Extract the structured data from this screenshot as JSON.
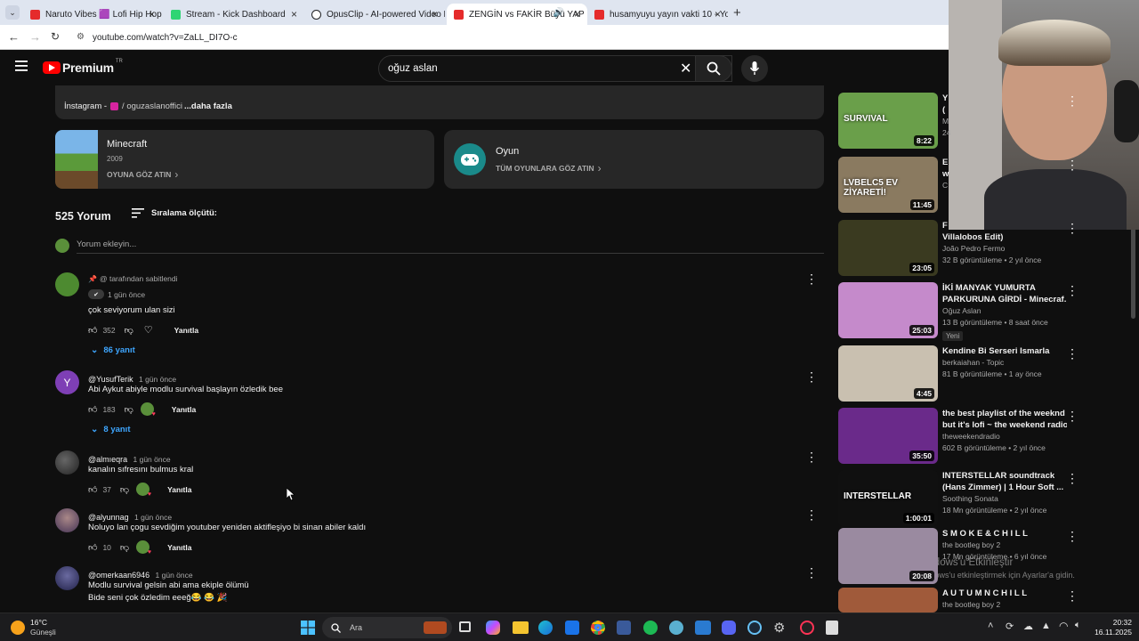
{
  "browser": {
    "tabs": [
      {
        "title": "Naruto Vibes 🟪 Lofi Hip Hop •",
        "color": "#e52b2b",
        "active": false
      },
      {
        "title": "Stream - Kick Dashboard",
        "color": "#2ed573",
        "active": false
      },
      {
        "title": "OpusClip - AI-powered Video R",
        "color": "#202124",
        "active": false
      },
      {
        "title": "ZENGİN vs FAKİR Büyü YAP",
        "color": "#e52b2b",
        "active": true
      },
      {
        "title": "husamyuyu yayın vakti 10 - You",
        "color": "#e52b2b",
        "active": false
      }
    ],
    "url": "youtube.com/watch?v=ZaLL_DI7O-c"
  },
  "youtube": {
    "logo": "Premium",
    "country": "TR",
    "search_value": "oğuz aslan"
  },
  "description": {
    "instagram_label": "İnstagram -",
    "instagram_link": "/ oguzaslanoffici",
    "more": "...daha fazla"
  },
  "game_cards": [
    {
      "title": "Minecraft",
      "year": "2009",
      "action": "OYUNA GÖZ ATIN"
    },
    {
      "title": "Oyun",
      "year": "",
      "action": "TÜM OYUNLARA GÖZ ATIN"
    }
  ],
  "comments_header": {
    "count": "525 Yorum",
    "sort": "Sıralama ölçütü:",
    "add_placeholder": "Yorum ekleyin..."
  },
  "comments": [
    {
      "pinned": "@ tarafından sabitlendi",
      "author": "",
      "time": "1 gün önce",
      "text": "çok seviyorum ulan sizi",
      "text2": "",
      "likes": "352",
      "reply": "Yanıtla",
      "replies": "86 yanıt",
      "avatar_color": "#5a8f3a"
    },
    {
      "pinned": "",
      "author": "@YusufTerik",
      "time": "1 gün önce",
      "text": "Abi Aykut abiyle modlu survival başlayın özledik bee",
      "text2": "",
      "likes": "183",
      "reply": "Yanıtla",
      "replies": "8 yanıt",
      "avatar_color": "#7e3fb5",
      "initial": "Y"
    },
    {
      "pinned": "",
      "author": "@almıeqra",
      "time": "1 gün önce",
      "text": "kanalın sıfresını bulmus kral",
      "text2": "",
      "likes": "37",
      "reply": "Yanıtla",
      "replies": "",
      "avatar_color": "#444"
    },
    {
      "pinned": "",
      "author": "@alyunnag",
      "time": "1 gün önce",
      "text": "Noluyo lan çogu sevdiğim youtuber yeniden aktifleşiyo bi sinan abiler kaldı",
      "text2": "",
      "likes": "10",
      "reply": "Yanıtla",
      "replies": "",
      "avatar_color": "#6a4f7a"
    },
    {
      "pinned": "",
      "author": "@omerkaan6946",
      "time": "1 gün önce",
      "text": "Modlu survival gelsin abi ama ekiple ölümü",
      "text2": "Bide seni çok özledim eeeğ😂 😂 🎉",
      "likes": "",
      "reply": "",
      "replies": "",
      "avatar_color": "#3a3a6a"
    }
  ],
  "sidebar": [
    {
      "title": "Y",
      "title2": "(",
      "channel": "M",
      "meta": "24",
      "duration": "8:22",
      "thumb": "#6a9f4a",
      "thumb_text": "SURVIVAL"
    },
    {
      "title": "E",
      "title2": "w",
      "channel": "C",
      "meta": "",
      "duration": "11:45",
      "thumb": "#8a7a60",
      "thumb_text": "LVBELC5 EV ZİYARETİ!"
    },
    {
      "title": "F",
      "title2": "Villalobos Edit)",
      "channel": "João Pedro Fermo",
      "meta": "32 B görüntüleme • 2 yıl önce",
      "duration": "23:05",
      "thumb": "#3a3a20",
      "thumb_text": ""
    },
    {
      "title": "İKİ MANYAK YUMURTA",
      "title2": "PARKURUNA GİRDİ - Minecraf...",
      "channel": "Oğuz Aslan",
      "meta": "13 B görüntüleme • 8 saat önce",
      "badge": "Yeni",
      "duration": "25:03",
      "thumb": "#c58acb",
      "thumb_text": ""
    },
    {
      "title": "Kendine Bi Serseri Ismarla",
      "title2": "",
      "channel": "berkaiahan - Topic",
      "meta": "81 B görüntüleme • 1 ay önce",
      "duration": "4:45",
      "thumb": "#c9c0b0",
      "thumb_text": ""
    },
    {
      "title": "the best playlist of the weeknd",
      "title2": "but it's lofi ~ the weekend radio",
      "channel": "theweekendradio",
      "meta": "602 B görüntüleme • 2 yıl önce",
      "duration": "35:50",
      "thumb": "#6a2a8a",
      "thumb_text": ""
    },
    {
      "title": "INTERSTELLAR soundtrack",
      "title2": "(Hans Zimmer) | 1 Hour Soft ...",
      "channel": "Soothing Sonata",
      "meta": "18 Mn görüntüleme • 2 yıl önce",
      "duration": "1:00:01",
      "thumb": "#101010",
      "thumb_text": "INTERSTELLAR"
    },
    {
      "title": "S M O K E  &  C H I L L",
      "title2": "",
      "channel": "the bootleg boy 2",
      "meta": "17 Mn görüntüleme • 6 yıl önce",
      "duration": "20:08",
      "thumb": "#9a8aa0",
      "thumb_text": ""
    },
    {
      "title": "A U T U M N   C H I L L",
      "title2": "",
      "channel": "the bootleg boy 2",
      "meta": "",
      "duration": "",
      "thumb": "#a05a3a",
      "thumb_text": ""
    }
  ],
  "windows_watermark": {
    "line1": "Windows'u Etkinleştir",
    "line2": "Windows'u etkinleştirmek için Ayarlar'a gidin."
  },
  "taskbar": {
    "weather_temp": "16°C",
    "weather_desc": "Güneşli",
    "search": "Ara",
    "time": "20:32",
    "date": "16.11.2025"
  }
}
